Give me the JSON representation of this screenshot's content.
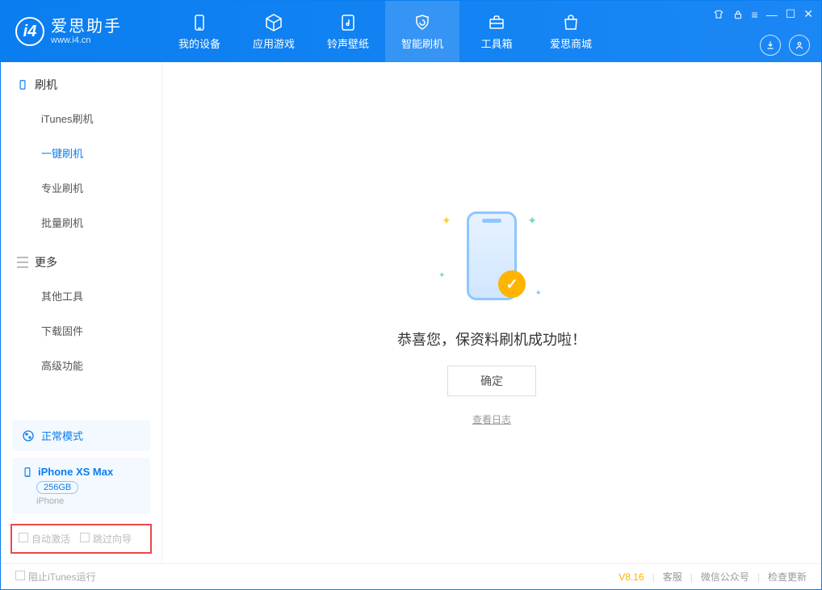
{
  "header": {
    "logo_title": "爱思助手",
    "logo_sub": "www.i4.cn",
    "tabs": [
      {
        "label": "我的设备"
      },
      {
        "label": "应用游戏"
      },
      {
        "label": "铃声壁纸"
      },
      {
        "label": "智能刷机"
      },
      {
        "label": "工具箱"
      },
      {
        "label": "爱思商城"
      }
    ]
  },
  "sidebar": {
    "group1_title": "刷机",
    "group1_items": [
      {
        "label": "iTunes刷机"
      },
      {
        "label": "一键刷机"
      },
      {
        "label": "专业刷机"
      },
      {
        "label": "批量刷机"
      }
    ],
    "group2_title": "更多",
    "group2_items": [
      {
        "label": "其他工具"
      },
      {
        "label": "下载固件"
      },
      {
        "label": "高级功能"
      }
    ],
    "status_mode": "正常模式",
    "device_name": "iPhone XS Max",
    "device_storage": "256GB",
    "device_type": "iPhone",
    "checkbox1": "自动激活",
    "checkbox2": "跳过向导"
  },
  "main": {
    "success_text": "恭喜您，保资料刷机成功啦！",
    "confirm_label": "确定",
    "log_link": "查看日志"
  },
  "footer": {
    "block_itunes": "阻止iTunes运行",
    "version": "V8.16",
    "link1": "客服",
    "link2": "微信公众号",
    "link3": "检查更新"
  }
}
